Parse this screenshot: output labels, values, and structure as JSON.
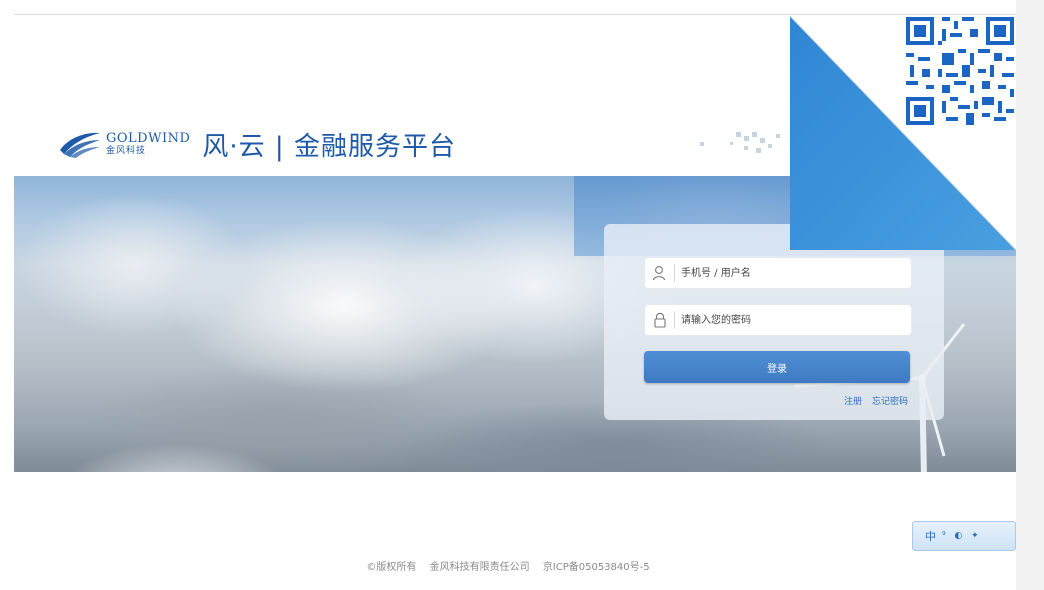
{
  "header": {
    "logo_en": "GOLDWIND",
    "logo_cn": "金风科技",
    "title": "风·云 | 金融服务平台"
  },
  "login": {
    "username_placeholder": "手机号 / 用户名",
    "password_placeholder": "请输入您的密码",
    "submit_label": "登录",
    "register_label": "注册",
    "forgot_label": "忘记密码"
  },
  "footer": {
    "copyright": "©版权所有",
    "company": "金风科技有限责任公司",
    "icp": "京ICP备05053840号-5"
  },
  "lang_widget": {
    "label": "中",
    "glyphs": "⁹ ◐ ✦"
  },
  "icons": {
    "user": "user-icon",
    "lock": "lock-icon",
    "qr": "qr-code-icon",
    "logo": "goldwind-swoosh-icon"
  },
  "colors": {
    "brand_blue": "#1e5aa8",
    "button_blue": "#4f8ed6",
    "fold_blue": "#3a8fd6",
    "link_blue": "#2f6fbf"
  }
}
